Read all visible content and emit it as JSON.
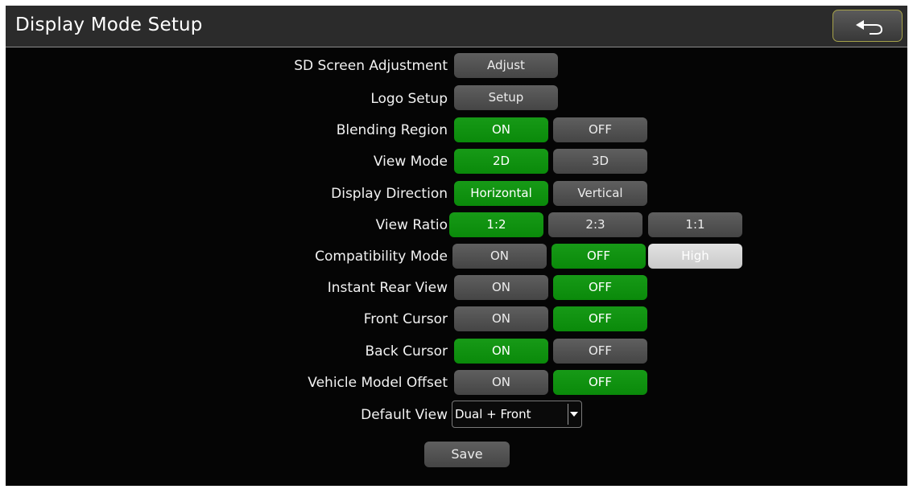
{
  "header": {
    "title": "Display Mode Setup",
    "back_icon": "back-arrow-icon"
  },
  "colors": {
    "selected": "#0f920f",
    "unselected": "#4e4e4e",
    "light": "#d3d3d3",
    "background": "#050505"
  },
  "settings": {
    "sd_screen": {
      "label": "SD Screen Adjustment",
      "button": "Adjust"
    },
    "logo": {
      "label": "Logo Setup",
      "button": "Setup"
    },
    "blending": {
      "label": "Blending Region",
      "options": [
        "ON",
        "OFF"
      ],
      "selected": "ON"
    },
    "view_mode": {
      "label": "View Mode",
      "options": [
        "2D",
        "3D"
      ],
      "selected": "2D"
    },
    "direction": {
      "label": "Display Direction",
      "options": [
        "Horizontal",
        "Vertical"
      ],
      "selected": "Horizontal"
    },
    "ratio": {
      "label": "View Ratio",
      "options": [
        "1:2",
        "2:3",
        "1:1"
      ],
      "selected": "1:2"
    },
    "compat": {
      "label": "Compatibility Mode",
      "options": [
        "ON",
        "OFF",
        "High"
      ],
      "selected": "OFF"
    },
    "instant_rear": {
      "label": "Instant Rear View",
      "options": [
        "ON",
        "OFF"
      ],
      "selected": "OFF"
    },
    "front_cursor": {
      "label": "Front Cursor",
      "options": [
        "ON",
        "OFF"
      ],
      "selected": "OFF"
    },
    "back_cursor": {
      "label": "Back Cursor",
      "options": [
        "ON",
        "OFF"
      ],
      "selected": "ON"
    },
    "vehicle_offset": {
      "label": "Vehicle Model Offset",
      "options": [
        "ON",
        "OFF"
      ],
      "selected": "OFF"
    },
    "default_view": {
      "label": "Default View",
      "value": "Dual + Front"
    }
  },
  "footer": {
    "save_label": "Save"
  }
}
